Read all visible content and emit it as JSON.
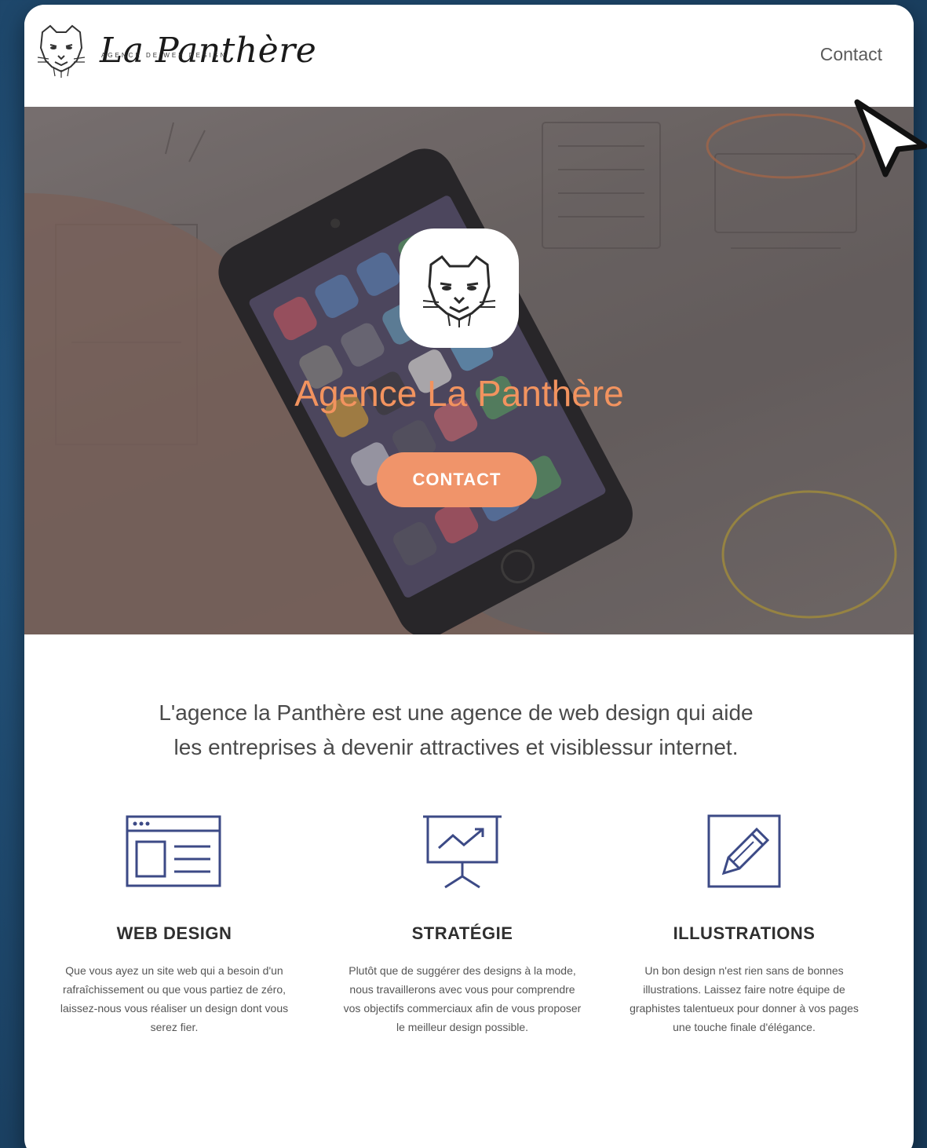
{
  "header": {
    "logo_text": "La Panthère",
    "logo_tagline": "AGENCE DE WEB DESIGN",
    "logo_icon": "panther-logo-icon",
    "nav_contact": "Contact"
  },
  "hero": {
    "badge_icon": "panther-head-icon",
    "title": "Agence La Panthère",
    "button_label": "CONTACT",
    "accent_color": "#f0946a"
  },
  "intro": {
    "line1": "L'agence la Panthère est une agence de web design qui aide",
    "line2": "les entreprises à devenir attractives et visiblessur internet."
  },
  "features": [
    {
      "icon": "browser-window-icon",
      "title": "WEB DESIGN",
      "text": "Que vous ayez un site web qui a besoin d'un rafraîchissement ou que vous partiez de zéro, laissez-nous vous réaliser un design dont vous serez fier."
    },
    {
      "icon": "presentation-chart-icon",
      "title": "STRATÉGIE",
      "text": "Plutôt que de suggérer des designs à la mode, nous travaillerons avec vous pour comprendre vos objectifs commerciaux afin de vous proposer le meilleur design possible."
    },
    {
      "icon": "pencil-icon",
      "title": "ILLUSTRATIONS",
      "text": "Un bon design n'est rien sans de bonnes illustrations. Laissez faire notre équipe de graphistes talentueux pour donner à vos pages une touche finale d'élégance."
    }
  ]
}
